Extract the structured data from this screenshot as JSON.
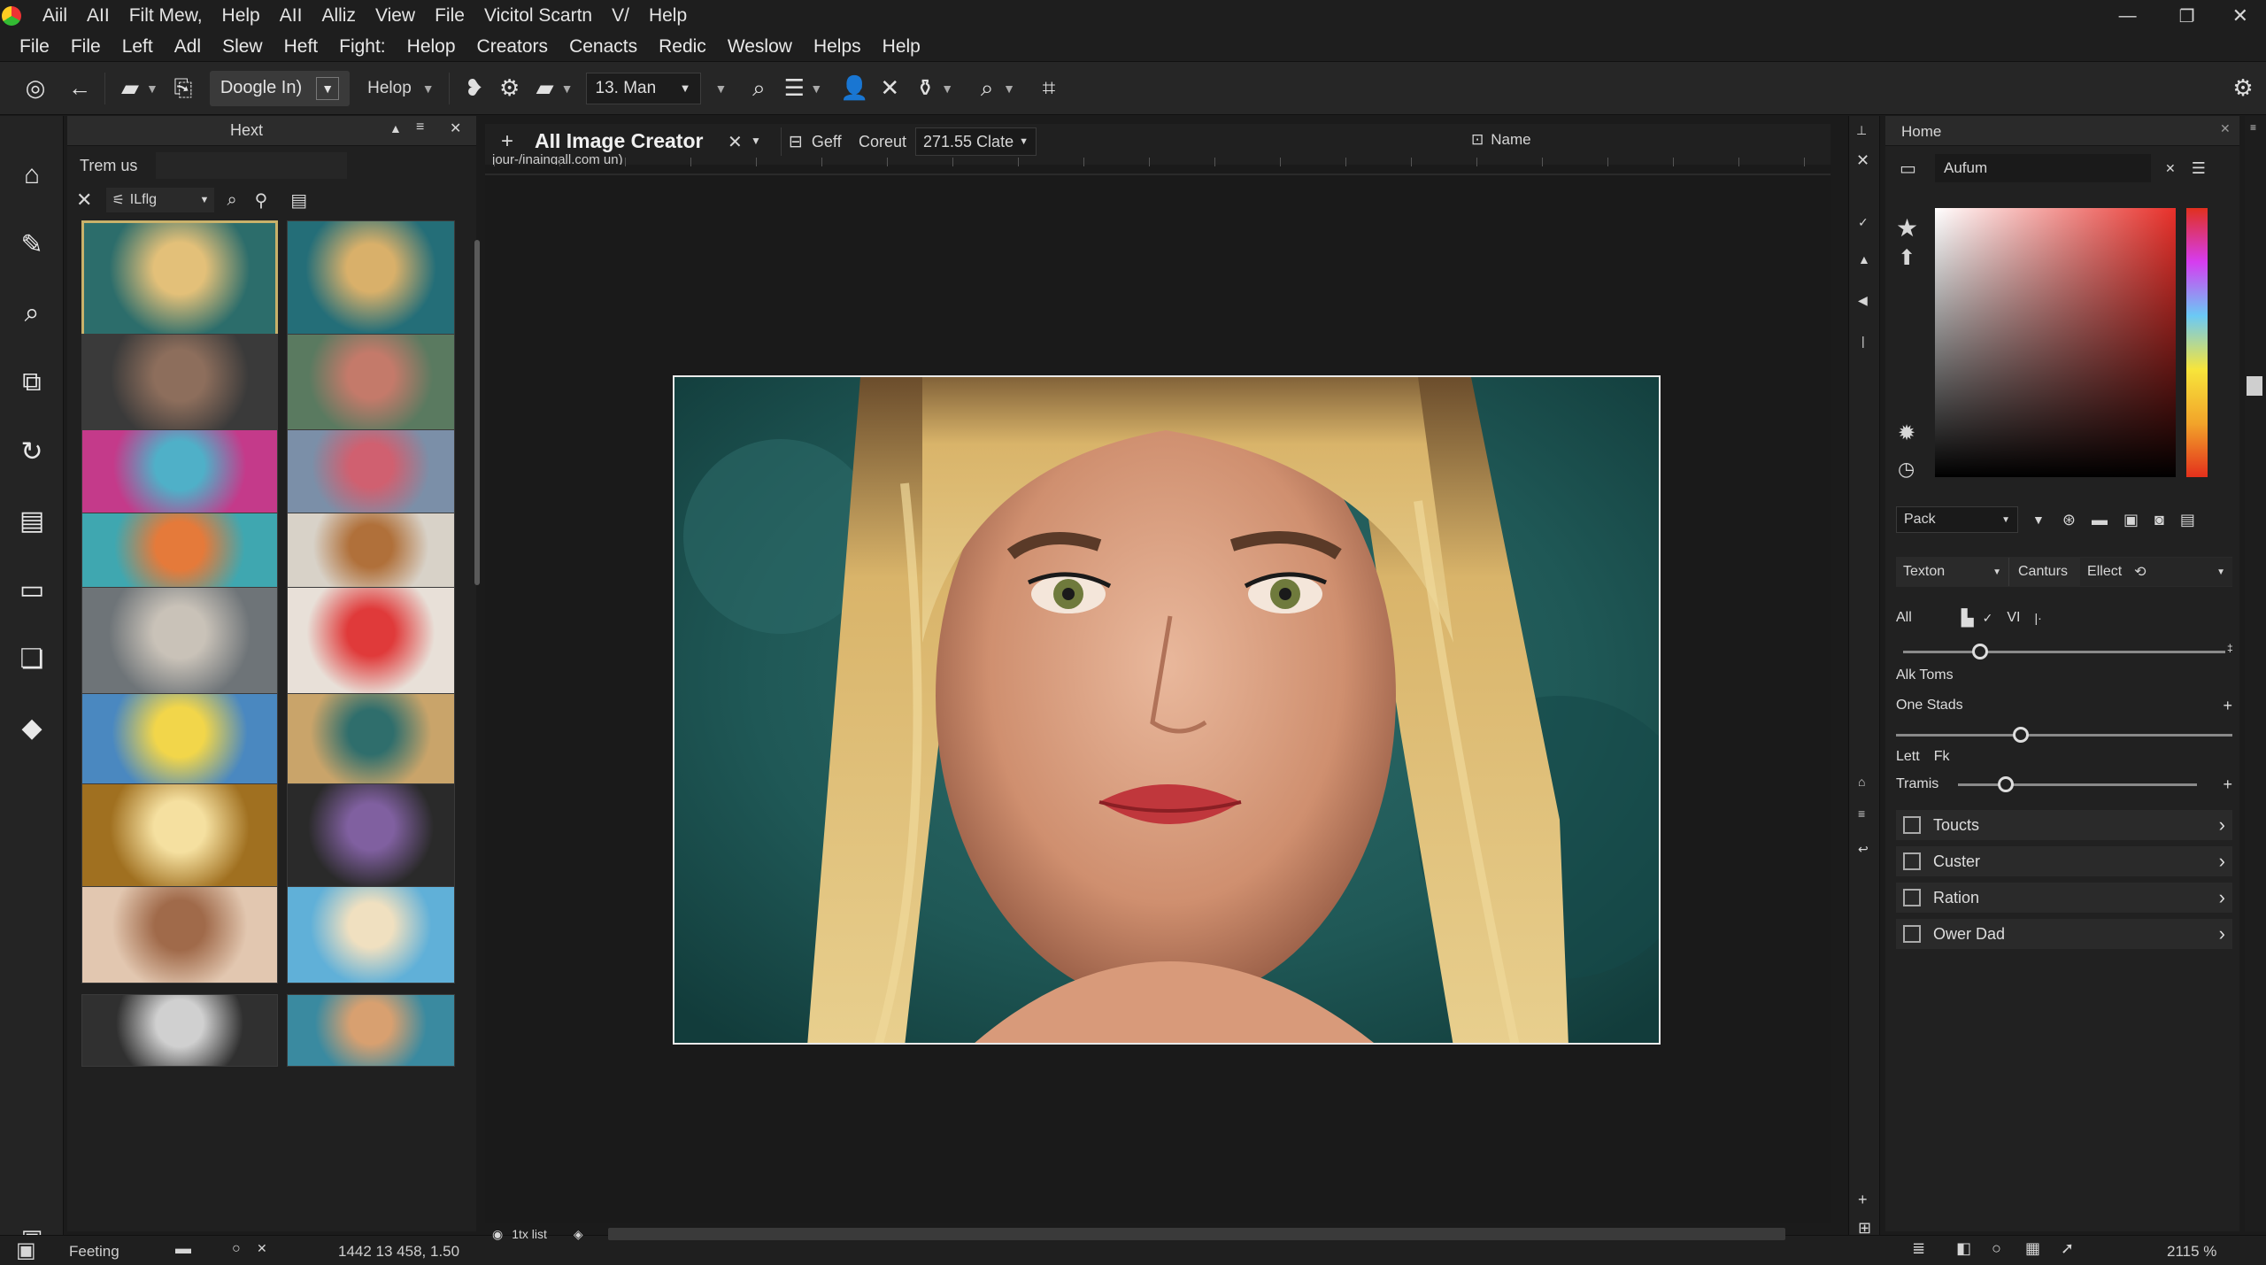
{
  "titlebar": {
    "items": [
      "Aiil",
      "AII",
      "Filt Mew,",
      "Help",
      "AII",
      "Alliz",
      "View",
      "File",
      "Vicitol Scartn",
      "V/",
      "Help"
    ]
  },
  "menubar": {
    "items": [
      "File",
      "File",
      "Left",
      "Adl",
      "Slew",
      "Heft",
      "Fight:",
      "Helop",
      "Creators",
      "Cenacts",
      "Redic",
      "Weslow",
      "Helps",
      "Help"
    ]
  },
  "toolbar": {
    "doogle_label": "Doogle In)",
    "helop_label": "Helop",
    "zoom_select": "13. Man"
  },
  "browser": {
    "title": "Hext",
    "search_label": "Trem us",
    "filter_label": "ILflg"
  },
  "document": {
    "tab_title": "AII Image Creator",
    "url": "jour-/inaingall.com un)",
    "geff_label": "Geff",
    "coreut_label": "Coreut",
    "size_select": "271.55 Clate",
    "name_label": "Name"
  },
  "rpanel": {
    "home_label": "Home",
    "preset_field": "Aufum",
    "pack_select": "Pack",
    "texton_select": "Texton",
    "canturs_label": "Canturs",
    "effect_select": "Ellect",
    "all_label": "All",
    "vi_label": "VI",
    "alk_toms": "Alk Toms",
    "one_stads": "One Stads",
    "lett": "Lett",
    "fk": "Fk",
    "tramis": "Tramis",
    "sliders": {
      "top": 0.24,
      "one_stads": 0.37,
      "tramis": 0.2
    },
    "checks": [
      "Toucts",
      "Custer",
      "Ration",
      "Ower Dad"
    ]
  },
  "status": {
    "left": "Feeting",
    "coords": "1442 13 458, 1.50",
    "hscroll": "1tx list",
    "zoom": "2115 %"
  },
  "colors": {
    "accent": "#c9b16a",
    "bg": "#1b1b1b",
    "panel": "#212121"
  }
}
